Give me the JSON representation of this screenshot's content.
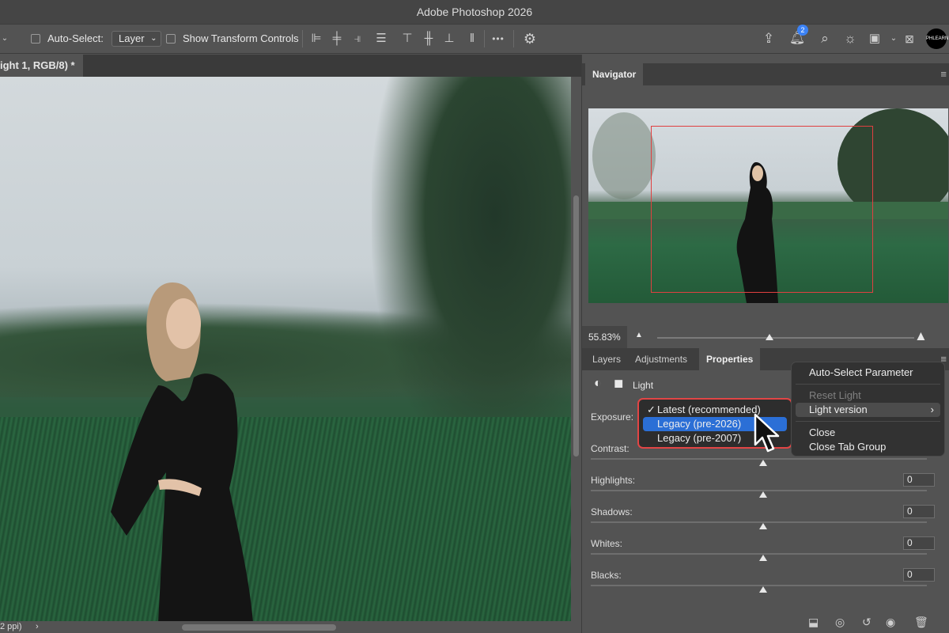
{
  "app": {
    "title": "Adobe Photoshop 2026"
  },
  "options_bar": {
    "auto_select_label": "Auto-Select:",
    "auto_select_target": "Layer",
    "show_transform_label": "Show Transform Controls",
    "more_label": "•••",
    "notification_count": "2",
    "avatar_text": "PHLEARN"
  },
  "document": {
    "tab_label": "ight 1, RGB/8) *",
    "status_text": "2 ppi)",
    "status_arrow": "›"
  },
  "navigator": {
    "tab_label": "Navigator",
    "zoom": "55.83%"
  },
  "panels": {
    "tabs": [
      {
        "label": "Layers"
      },
      {
        "label": "Adjustments"
      },
      {
        "label": "Properties"
      }
    ],
    "active_tab": "Properties"
  },
  "properties": {
    "layer_name": "Light",
    "sliders": [
      {
        "label": "Exposure:",
        "value": ""
      },
      {
        "label": "Contrast:",
        "value": ""
      },
      {
        "label": "Highlights:",
        "value": "0"
      },
      {
        "label": "Shadows:",
        "value": "0"
      },
      {
        "label": "Whites:",
        "value": "0"
      },
      {
        "label": "Blacks:",
        "value": "0"
      }
    ]
  },
  "version_dropdown": {
    "check": "✓",
    "items": [
      {
        "label": "Latest (recommended)",
        "checked": true
      },
      {
        "label": "Legacy (pre-2026)",
        "selected": true
      },
      {
        "label": "Legacy (pre-2007)"
      }
    ]
  },
  "context_menu": {
    "items": [
      {
        "label": "Auto-Select Parameter"
      },
      {
        "label": "Reset Light",
        "disabled": true
      },
      {
        "label": "Light version",
        "submenu": "›"
      },
      {
        "label": "Close"
      },
      {
        "label": "Close Tab Group"
      }
    ]
  },
  "colors": {
    "highlight_blue": "#2b6fd6",
    "annotation_red": "#e24545",
    "badge_blue": "#3b82f6"
  }
}
